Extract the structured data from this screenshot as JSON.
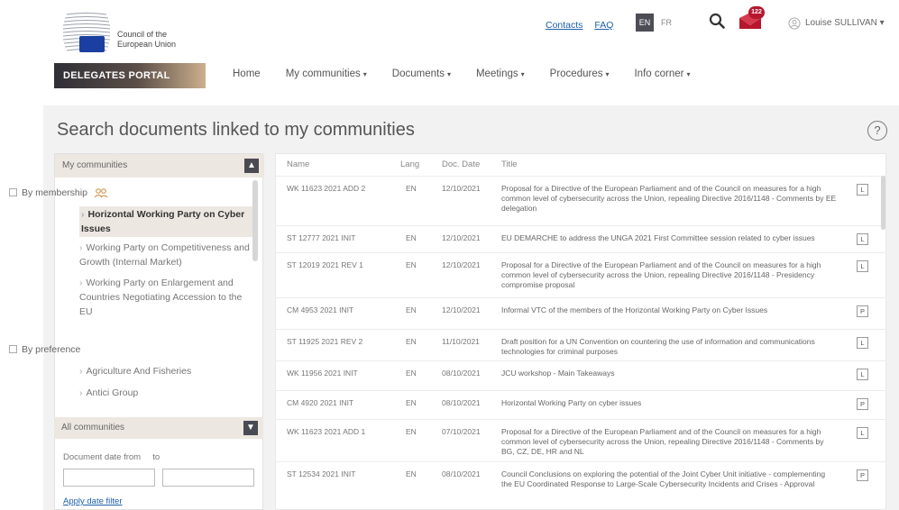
{
  "header": {
    "logo_text_line1": "Council of the",
    "logo_text_line2": "European Union",
    "portal_label": "DELEGATES PORTAL",
    "nav": [
      {
        "label": "Home"
      },
      {
        "label": "My communities",
        "caret": "▾"
      },
      {
        "label": "Documents",
        "caret": "▾"
      },
      {
        "label": "Meetings",
        "caret": "▾"
      },
      {
        "label": "Procedures",
        "caret": "▾"
      },
      {
        "label": "Info corner",
        "caret": "▾"
      }
    ],
    "links": {
      "contacts": "Contacts",
      "faq": "FAQ"
    },
    "lang_en": "EN",
    "lang_fr": "FR",
    "mail_count": "122",
    "user_name": "Louise SULLIVAN",
    "user_caret": "▾",
    "icons": {
      "search": "search-icon",
      "mail": "mail-icon",
      "user": "user-icon",
      "help": "help-icon"
    },
    "colors": {
      "accent": "#1d60a8",
      "badge": "#b6172e",
      "portal_dark": "#2f2f36"
    }
  },
  "page": {
    "title": "Search documents linked to my communities",
    "help": "?"
  },
  "sidebar": {
    "my_communities": "My communities",
    "toggle_up": "▲",
    "by_membership": "By membership",
    "membership_items": [
      "Horizontal Working Party on Cyber Issues",
      "Working Party on Competitiveness and Growth (Internal Market)",
      "Working Party on Enlargement and Countries Negotiating Accession to the EU"
    ],
    "by_preference": "By preference",
    "preference_items": [
      "Agriculture And Fisheries",
      "Antici Group"
    ],
    "all_communities": "All communities",
    "toggle_down": "▼",
    "date_from": "Document date from",
    "date_to": "to",
    "apply": "Apply date filter"
  },
  "table": {
    "headers": {
      "name": "Name",
      "lang": "Lang",
      "date": "Doc. Date",
      "title": "Title"
    },
    "rows": [
      {
        "name": "WK 11623 2021 ADD 2",
        "lang": "EN",
        "date": "12/10/2021",
        "title": "Proposal for a Directive of the European Parliament and of the Council on measures for a high common level of cybersecurity across the Union, repealing Directive 2016/1148 - Comments by EE delegation",
        "type": "L"
      },
      {
        "name": "ST 12777 2021 INIT",
        "lang": "EN",
        "date": "12/10/2021",
        "title": "EU DEMARCHE to address the UNGA 2021 First Committee session related to cyber issues",
        "type": "L"
      },
      {
        "name": "ST 12019 2021 REV 1",
        "lang": "EN",
        "date": "12/10/2021",
        "title": "Proposal for a Directive of the European Parliament and of the Council on measures for a high common level of cybersecurity across the Union, repealing Directive 2016/1148 - Presidency compromise proposal",
        "type": "L"
      },
      {
        "name": "CM 4953 2021 INIT",
        "lang": "EN",
        "date": "12/10/2021",
        "title": "Informal VTC of the members of the Horizontal Working Party on Cyber Issues",
        "type": "P"
      },
      {
        "name": "ST 11925 2021 REV 2",
        "lang": "EN",
        "date": "11/10/2021",
        "title": "Draft position for a UN Convention on countering the use of information and communications technologies for criminal purposes",
        "type": "L"
      },
      {
        "name": "WK 11956 2021 INIT",
        "lang": "EN",
        "date": "08/10/2021",
        "title": "JCU workshop - Main Takeaways",
        "type": "L"
      },
      {
        "name": "CM 4920 2021 INIT",
        "lang": "EN",
        "date": "08/10/2021",
        "title": "Horizontal Working Party on cyber issues",
        "type": "P"
      },
      {
        "name": "WK 11623 2021 ADD 1",
        "lang": "EN",
        "date": "07/10/2021",
        "title": "Proposal for a Directive of the European Parliament and of the Council on measures for a high common level of cybersecurity across the Union, repealing Directive 2016/1148 - Comments by BG, CZ, DE, HR and NL",
        "type": "L"
      },
      {
        "name": "ST 12534 2021 INIT",
        "lang": "EN",
        "date": "08/10/2021",
        "title": "Council Conclusions on exploring the potential of the Joint Cyber Unit initiative - complementing the EU Coordinated Response to Large-Scale Cybersecurity Incidents and Crises - Approval",
        "type": "P"
      }
    ]
  }
}
